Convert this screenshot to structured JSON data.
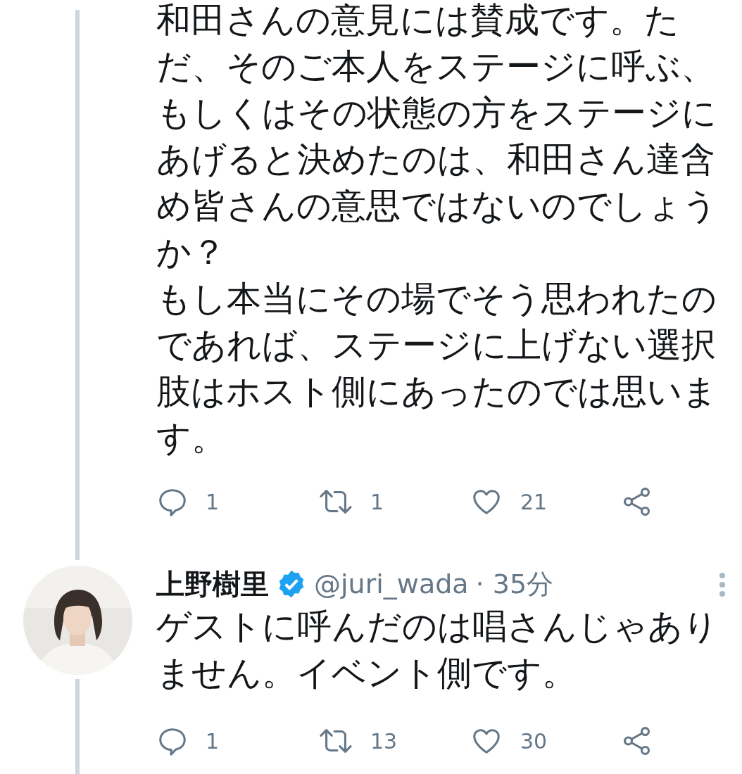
{
  "tweets": [
    {
      "lines": [
        "和田さんの意見には賛成です。た",
        "だ、そのご本人をステージに呼ぶ、",
        "もしくはその状態の方をステージに",
        "あげると決めたのは、和田さん達含",
        "め皆さんの意思ではないのでしょう",
        "か？",
        "もし本当にその場でそう思われたの",
        "であれば、ステージに上げない選択",
        "肢はホスト側にあったのでは思いま",
        "す。"
      ],
      "actions": {
        "replies": "1",
        "retweets": "1",
        "likes": "21"
      }
    },
    {
      "author": {
        "name": "上野樹里",
        "verified": true,
        "handle": "@juri_wada",
        "time": "· 35分"
      },
      "lines": [
        "ゲストに呼んだのは唱さんじゃあり",
        "ません。イベント側です。"
      ],
      "actions": {
        "replies": "1",
        "retweets": "13",
        "likes": "30"
      }
    }
  ]
}
